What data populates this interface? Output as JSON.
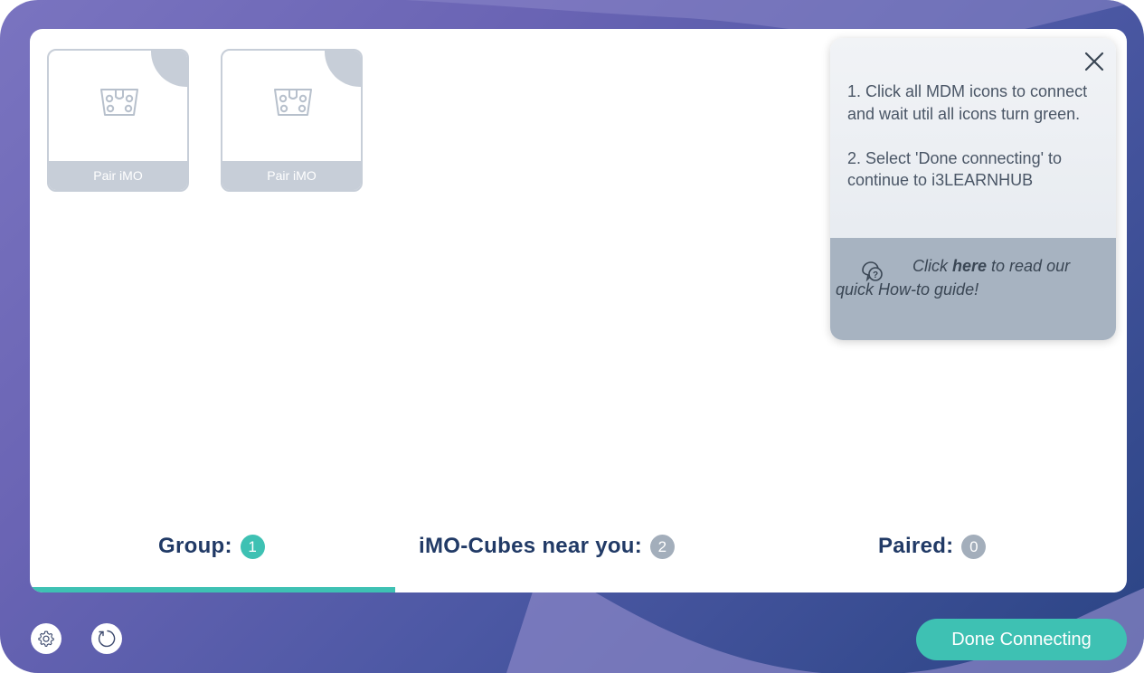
{
  "devices": [
    {
      "icon": "mdm-device-icon",
      "label": "Pair iMO"
    },
    {
      "icon": "mdm-device-icon",
      "label": "Pair iMO"
    }
  ],
  "tabs": [
    {
      "label": "Group:",
      "count": "1",
      "color": "#3ec1b3",
      "active": true
    },
    {
      "label": "iMO-Cubes near you:",
      "count": "2",
      "color": "#a3aebb",
      "active": false
    },
    {
      "label": "Paired:",
      "count": "0",
      "color": "#a3aebb",
      "active": false
    }
  ],
  "help": {
    "step1": "1. Click all MDM icons to connect and wait util all icons turn green.",
    "step2": "2. Select 'Done connecting' to continue to i3LEARNHUB",
    "guide_pre": "Click ",
    "guide_link": "here",
    "guide_post": " to read our quick How-to guide!",
    "close_icon": "close-icon",
    "guide_icon": "question-bubble-icon"
  },
  "footer": {
    "settings_icon": "gear-icon",
    "refresh_icon": "refresh-icon",
    "done_label": "Done Connecting"
  },
  "colors": {
    "accent": "#3ec1b3",
    "badge_inactive": "#a3aebb",
    "tab_text": "#213a66"
  }
}
